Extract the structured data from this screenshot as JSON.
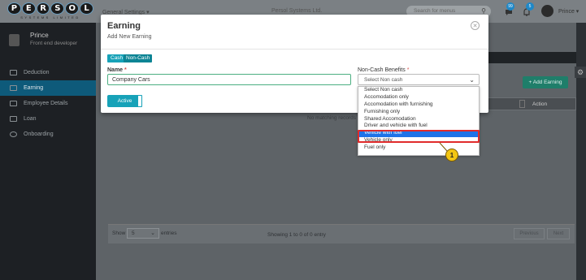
{
  "header": {
    "logo_text": "PERSOL",
    "logo_sub": "SYSTEMS LIMITED",
    "settings_dropdown": "General Settings ▾",
    "company_dropdown": "Persol Systems Ltd.",
    "search_placeholder": "Search for menus",
    "notification_badge_1": "99",
    "notification_badge_2": "5",
    "user_name": "Prince ▾"
  },
  "sidebar": {
    "profile_name": "Prince",
    "profile_role": "Front end developer",
    "items": [
      {
        "label": "Deduction",
        "active": false
      },
      {
        "label": "Earning",
        "active": true
      },
      {
        "label": "Employee Details",
        "active": false
      },
      {
        "label": "Loan",
        "active": false
      },
      {
        "label": "Onboarding",
        "active": false
      }
    ]
  },
  "page": {
    "add_button": "+ Add Earning",
    "table_action_header": "Action",
    "no_records": "No matching records",
    "show_label": "Show",
    "show_value": "5",
    "entries_label": "entries",
    "showing_text": "Showing 1 to 0 of 0 entry",
    "prev_label": "Previous",
    "next_label": "Next"
  },
  "modal": {
    "title": "Earning",
    "subtitle": "Add New Earning",
    "cash_label": "Cash",
    "noncash_label": "Non-Cash",
    "name_label": "Name",
    "required_mark": "*",
    "name_value": "Company Cars",
    "ncb_label": "Non-Cash Benefits",
    "ncb_selected": "Select Non cash",
    "active_label": "Active",
    "dropdown_options": [
      "Select Non cash",
      "Accomodation only",
      "Accomodation with furnishing",
      "Furnishing only",
      "Shared Accomodation",
      "Driver and vehicle with fuel",
      "Vehicle with fuel",
      "Vehicle only",
      "Fuel only"
    ],
    "highlighted_index": 6
  },
  "annotation": {
    "step_number": "1",
    "highlight_color": "#e02b2b",
    "callout_color": "#f3c614"
  },
  "colors": {
    "accent": "#17a2b8",
    "sidebar_active": "#0e5a7a",
    "option_selected": "#1e73e8"
  }
}
